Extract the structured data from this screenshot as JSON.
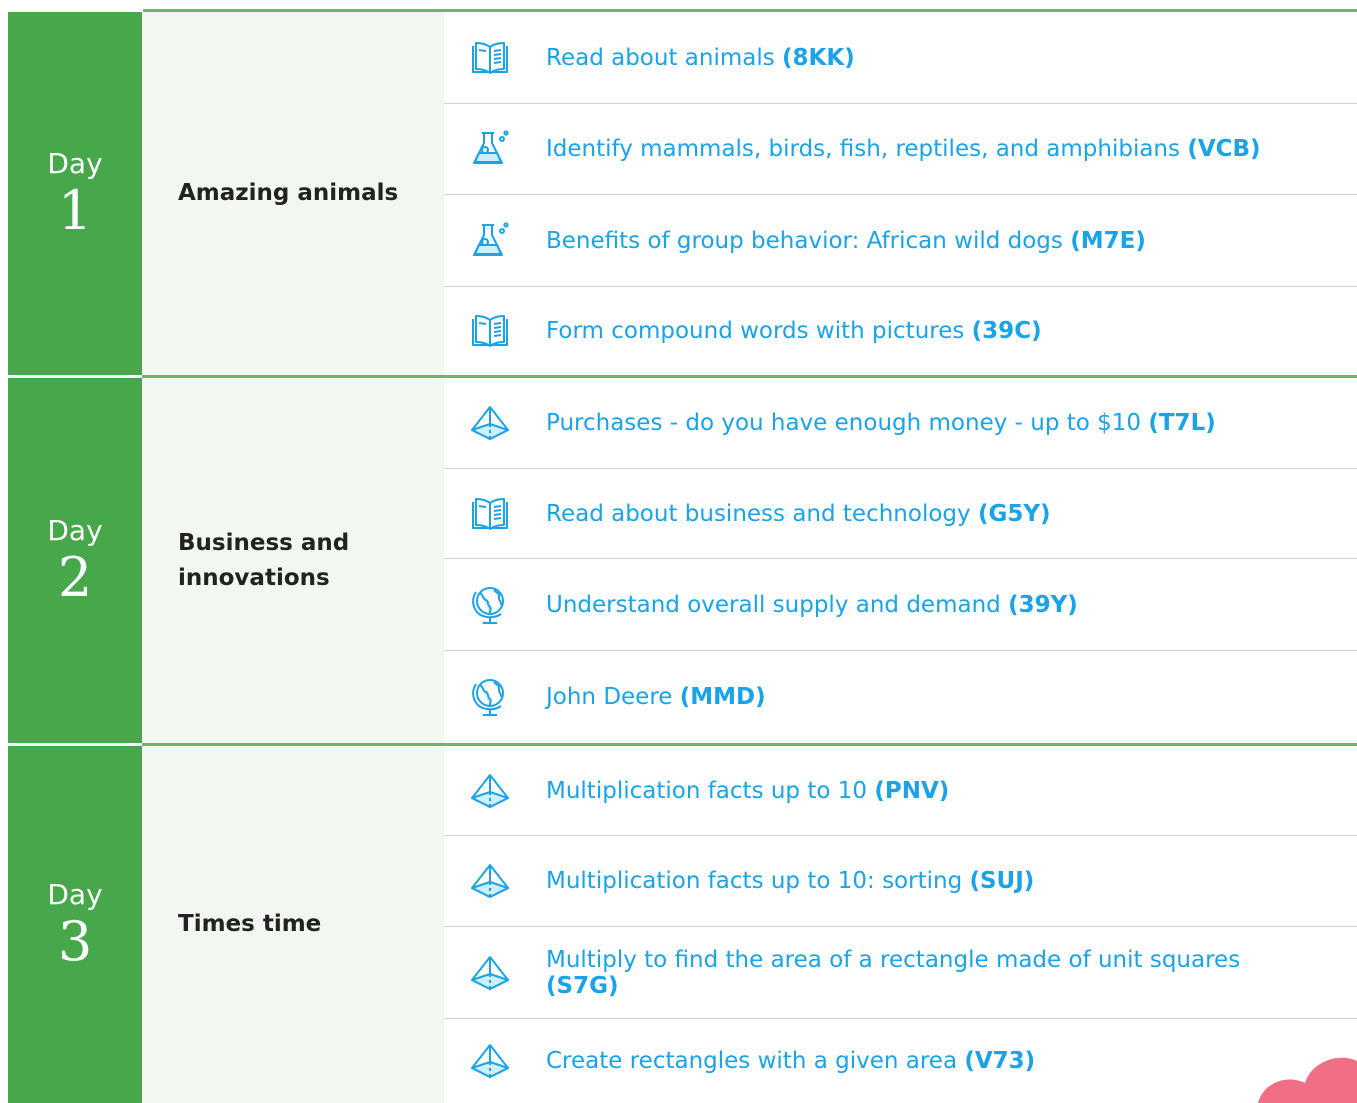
{
  "days": [
    {
      "day_word": "Day",
      "day_number": "1",
      "theme": "Amazing animals",
      "skills": [
        {
          "icon": "book-icon",
          "title": "Read about animals",
          "code": "(8KK)"
        },
        {
          "icon": "flask-icon",
          "title": "Identify mammals, birds, fish, reptiles, and amphibians",
          "code": "(VCB)"
        },
        {
          "icon": "flask-icon",
          "title": "Benefits of group behavior: African wild dogs",
          "code": "(M7E)"
        },
        {
          "icon": "book-icon",
          "title": "Form compound words with pictures",
          "code": "(39C)"
        }
      ]
    },
    {
      "day_word": "Day",
      "day_number": "2",
      "theme": "Business and innovations",
      "skills": [
        {
          "icon": "pyramid-icon",
          "title": "Purchases - do you have enough money - up to $10",
          "code": "(T7L)"
        },
        {
          "icon": "book-icon",
          "title": "Read about business and technology",
          "code": "(G5Y)"
        },
        {
          "icon": "globe-icon",
          "title": "Understand overall supply and demand",
          "code": "(39Y)"
        },
        {
          "icon": "globe-icon",
          "title": "John Deere",
          "code": "(MMD)"
        }
      ]
    },
    {
      "day_word": "Day",
      "day_number": "3",
      "theme": "Times time",
      "skills": [
        {
          "icon": "pyramid-icon",
          "title": "Multiplication facts up to 10",
          "code": "(PNV)"
        },
        {
          "icon": "pyramid-icon",
          "title": "Multiplication facts up to 10: sorting",
          "code": "(SUJ)"
        },
        {
          "icon": "pyramid-icon",
          "title": "Multiply to find the area of a rectangle made of unit squares",
          "code": "(S7G)"
        },
        {
          "icon": "pyramid-icon",
          "title": "Create rectangles with a given area",
          "code": "(V73)"
        }
      ]
    }
  ],
  "colors": {
    "day_green": "#47a74b",
    "theme_bg": "#f3f7f1",
    "link_blue": "#1aa3e8",
    "divider_green": "#6ab86b",
    "blob_pink": "#f06f86"
  }
}
